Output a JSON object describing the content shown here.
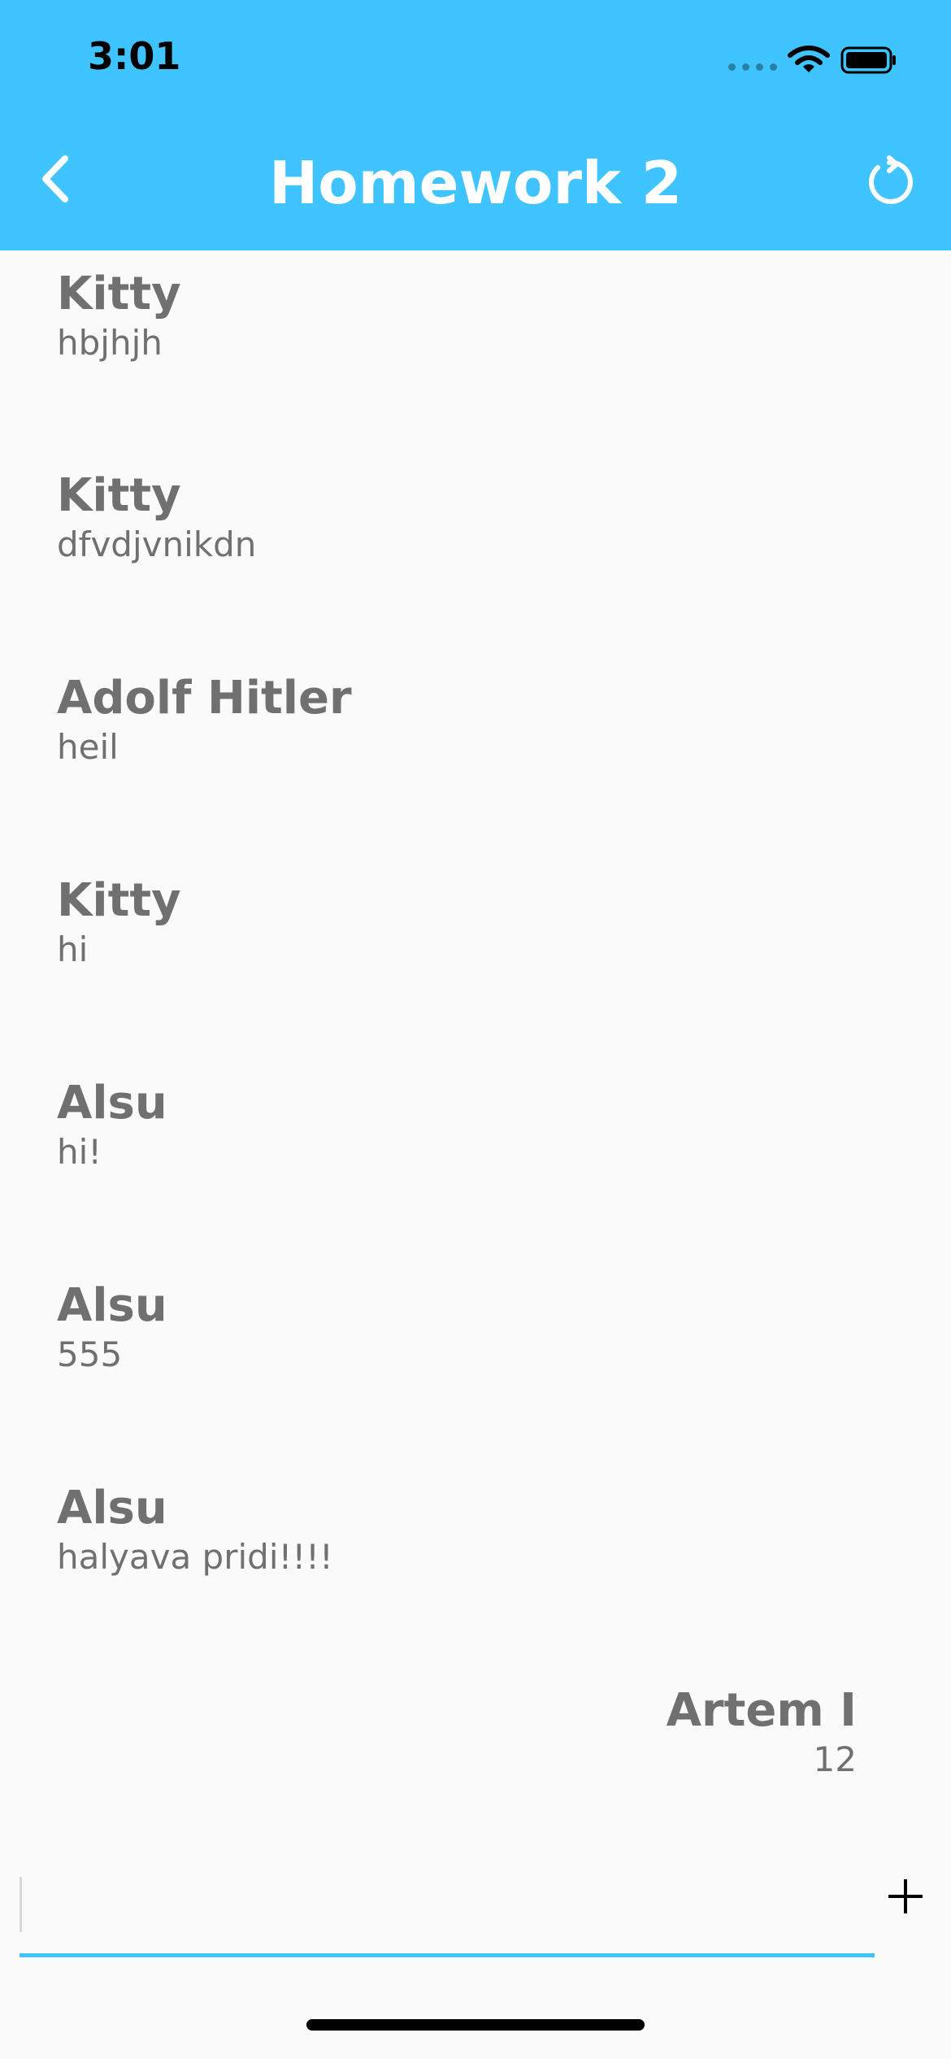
{
  "status": {
    "time": "3:01"
  },
  "header": {
    "title": "Homework 2",
    "back_icon": "chevron-left-icon",
    "refresh_icon": "refresh-icon"
  },
  "messages": [
    {
      "author": "Kitty",
      "text": "hbjhjh"
    },
    {
      "author": "Kitty",
      "text": "dfvdjvnikdn"
    },
    {
      "author": "Adolf Hitler",
      "text": "heil"
    },
    {
      "author": "Kitty",
      "text": "hi"
    },
    {
      "author": "Alsu",
      "text": "hi!"
    },
    {
      "author": "Alsu",
      "text": "555"
    },
    {
      "author": "Alsu",
      "text": "halyava pridi!!!!"
    },
    {
      "author": "Artem I",
      "text": "12"
    }
  ],
  "composer": {
    "value": "",
    "placeholder": "",
    "add_icon": "plus-icon"
  },
  "colors": {
    "accent": "#40c4ff",
    "background": "#fafafa",
    "message_text": "#707070"
  }
}
